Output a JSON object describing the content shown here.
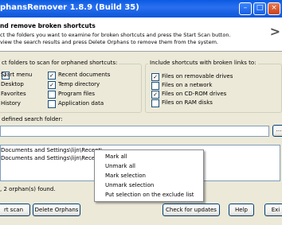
{
  "window": {
    "title": "phansRemover 1.8.9 (Build 35)",
    "controls": [
      "minimize-icon",
      "maximize-icon",
      "close-icon"
    ]
  },
  "header": {
    "title": "nd remove broken shortcuts",
    "line1": "ct the folders you want to examine for broken shortcuts and press the Start Scan button.",
    "line2": "view the search results and press Delete Orphans to remove them from the system.",
    "logo": ">"
  },
  "folders_group": {
    "title": "ct folders to scan for orphaned shortcuts:",
    "items": [
      {
        "label": "Start menu",
        "checked": true
      },
      {
        "label": "Recent documents",
        "checked": true
      },
      {
        "label": "Desktop",
        "checked": true
      },
      {
        "label": "Temp directory",
        "checked": true
      },
      {
        "label": "Favorites",
        "checked": false
      },
      {
        "label": "Program files",
        "checked": false
      },
      {
        "label": "History",
        "checked": false
      },
      {
        "label": "Application data",
        "checked": false
      }
    ]
  },
  "links_group": {
    "title": "Include shortcuts with broken links to:",
    "items": [
      {
        "label": "Files on removable drives",
        "checked": true
      },
      {
        "label": "Files on a network",
        "checked": false
      },
      {
        "label": "Files on CD-ROM drives",
        "checked": true
      },
      {
        "label": "Files on RAM disks",
        "checked": false
      }
    ]
  },
  "user_folder": {
    "label": "defined search folder:",
    "value": "",
    "browse_label": "..."
  },
  "results": [
    "Documents and Settings\\lijn\\Recent\\",
    "Documents and Settings\\lijn\\Recent\\"
  ],
  "context_menu": [
    "Mark all",
    "Unmark all",
    "Mark selection",
    "Unmark selection",
    "Put selection on the exclude list"
  ],
  "status": ", 2 orphan(s) found.",
  "buttons": {
    "start_scan": "rt scan",
    "delete_orphans": "Delete Orphans",
    "check_updates": "Check for updates",
    "help": "Help",
    "exit": "Exi"
  },
  "colors": {
    "titlebar": "#0a5be0",
    "face": "#ece9d8",
    "field_border": "#7f9db9",
    "button_border": "#003c74"
  }
}
